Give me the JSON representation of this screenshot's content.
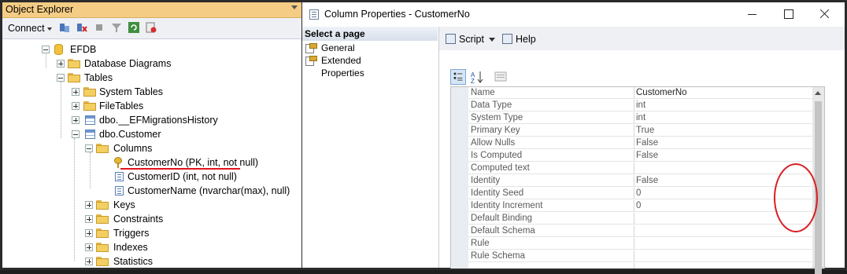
{
  "object_explorer": {
    "title": "Object Explorer",
    "connect_label": "Connect",
    "toolbar_icons": [
      "connect-db-icon",
      "disconnect-icon",
      "stop-icon",
      "filter-icon",
      "refresh-icon",
      "activity-monitor-icon"
    ],
    "tree": [
      {
        "label": "EFDB",
        "icon": "database-icon",
        "expander": "minus",
        "level": 0
      },
      {
        "label": "Database Diagrams",
        "icon": "folder-icon",
        "expander": "plus",
        "level": 1
      },
      {
        "label": "Tables",
        "icon": "folder-icon",
        "expander": "minus",
        "level": 1
      },
      {
        "label": "System Tables",
        "icon": "folder-icon",
        "expander": "plus",
        "level": 2
      },
      {
        "label": "FileTables",
        "icon": "folder-icon",
        "expander": "plus",
        "level": 2
      },
      {
        "label": "dbo.__EFMigrationsHistory",
        "icon": "table-icon",
        "expander": "plus",
        "level": 2
      },
      {
        "label": "dbo.Customer",
        "icon": "table-icon",
        "expander": "minus",
        "level": 2
      },
      {
        "label": "Columns",
        "icon": "folder-icon",
        "expander": "minus",
        "level": 3
      },
      {
        "label": "CustomerNo (PK, int, not null)",
        "icon": "primary-key-icon",
        "expander": "none",
        "level": 4
      },
      {
        "label": "CustomerID (int, not null)",
        "icon": "column-icon",
        "expander": "none",
        "level": 4
      },
      {
        "label": "CustomerName (nvarchar(max), null)",
        "icon": "column-icon",
        "expander": "none",
        "level": 4
      },
      {
        "label": "Keys",
        "icon": "folder-icon",
        "expander": "plus",
        "level": 3
      },
      {
        "label": "Constraints",
        "icon": "folder-icon",
        "expander": "plus",
        "level": 3
      },
      {
        "label": "Triggers",
        "icon": "folder-icon",
        "expander": "plus",
        "level": 3
      },
      {
        "label": "Indexes",
        "icon": "folder-icon",
        "expander": "plus",
        "level": 3
      },
      {
        "label": "Statistics",
        "icon": "folder-icon",
        "expander": "plus",
        "level": 3
      }
    ]
  },
  "window": {
    "title": "Column Properties - CustomerNo",
    "select_page_label": "Select a page",
    "pages": [
      {
        "label": "General",
        "icon": "page-general-icon"
      },
      {
        "label": "Extended Properties",
        "icon": "page-extended-icon"
      }
    ],
    "script_label": "Script",
    "help_label": "Help"
  },
  "properties": [
    {
      "name": "Name",
      "value": "CustomerNo"
    },
    {
      "name": "Data Type",
      "value": "int"
    },
    {
      "name": "System Type",
      "value": "int"
    },
    {
      "name": "Primary Key",
      "value": "True"
    },
    {
      "name": "Allow Nulls",
      "value": "False"
    },
    {
      "name": "Is Computed",
      "value": "False"
    },
    {
      "name": "Computed text",
      "value": ""
    },
    {
      "name": "Identity",
      "value": "False"
    },
    {
      "name": "Identity Seed",
      "value": "0"
    },
    {
      "name": "Identity Increment",
      "value": "0"
    },
    {
      "name": "Default Binding",
      "value": ""
    },
    {
      "name": "Default Schema",
      "value": ""
    },
    {
      "name": "Rule",
      "value": ""
    },
    {
      "name": "Rule Schema",
      "value": ""
    }
  ],
  "colors": {
    "oe_title_bg": "#f5cc84",
    "annotation_red": "#d81e22"
  }
}
